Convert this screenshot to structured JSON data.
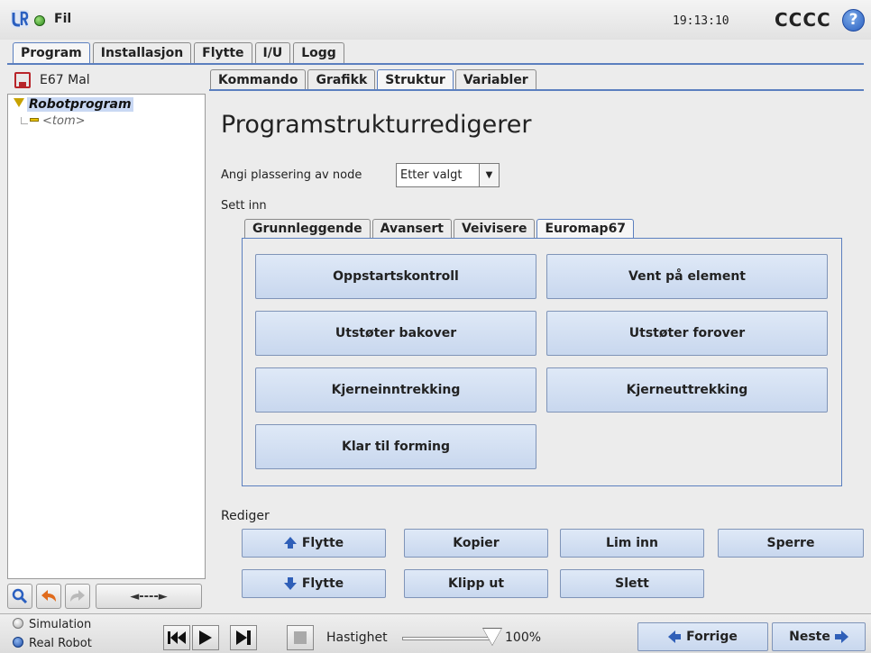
{
  "header": {
    "file_menu": "Fil",
    "clock": "19:13:10",
    "robot_name": "CCCC",
    "help": "?"
  },
  "main_tabs": [
    {
      "label": "Program",
      "active": true
    },
    {
      "label": "Installasjon",
      "active": false
    },
    {
      "label": "Flytte",
      "active": false
    },
    {
      "label": "I/U",
      "active": false
    },
    {
      "label": "Logg",
      "active": false
    }
  ],
  "left_panel": {
    "file_name": "E67 Mal",
    "tree_root": "Robotprogram",
    "tree_child": "<tom>",
    "nav_arrows": "◄----►"
  },
  "sub_tabs": [
    {
      "label": "Kommando",
      "active": false
    },
    {
      "label": "Grafikk",
      "active": false
    },
    {
      "label": "Struktur",
      "active": true
    },
    {
      "label": "Variabler",
      "active": false
    }
  ],
  "editor": {
    "title": "Programstrukturredigerer",
    "placement_label": "Angi plassering av node",
    "placement_value": "Etter valgt",
    "insert_label": "Sett inn",
    "edit_label": "Rediger"
  },
  "insert_tabs": [
    {
      "label": "Grunnleggende",
      "active": false
    },
    {
      "label": "Avansert",
      "active": false
    },
    {
      "label": "Veivisere",
      "active": false
    },
    {
      "label": "Euromap67",
      "active": true
    }
  ],
  "insert_buttons": {
    "startup_check": "Oppstartskontroll",
    "wait_for_part": "Vent på element",
    "ejector_back": "Utstøter bakover",
    "ejector_forward": "Utstøter forover",
    "core_in": "Kjerneinntrekking",
    "core_out": "Kjerneuttrekking",
    "ready_for_molding": "Klar til forming"
  },
  "edit_buttons": {
    "move_up": "Flytte",
    "copy": "Kopier",
    "paste": "Lim inn",
    "suppress": "Sperre",
    "move_down": "Flytte",
    "cut": "Klipp ut",
    "delete": "Slett"
  },
  "footer": {
    "mode_simulation": "Simulation",
    "mode_real": "Real Robot",
    "speed_label": "Hastighet",
    "speed_value": "100%",
    "speed_fraction": 1.0,
    "prev": "Forrige",
    "next": "Neste"
  },
  "colors": {
    "accent": "#5b7fbf",
    "button_fill": "#d4e1f3",
    "tree_node": "#e7c200"
  }
}
